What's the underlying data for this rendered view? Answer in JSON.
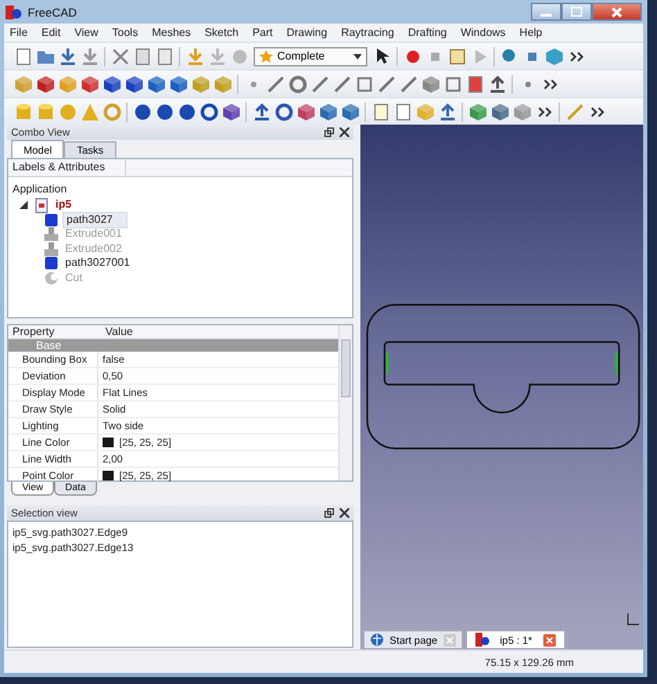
{
  "window": {
    "title": "FreeCAD"
  },
  "menu": [
    "File",
    "Edit",
    "View",
    "Tools",
    "Meshes",
    "Sketch",
    "Part",
    "Drawing",
    "Raytracing",
    "Drafting",
    "Windows",
    "Help"
  ],
  "toolbar": {
    "workbench": "Complete"
  },
  "combo_view": {
    "title": "Combo View",
    "tabs": [
      {
        "label": "Model",
        "selected": true
      },
      {
        "label": "Tasks",
        "selected": false
      }
    ],
    "tree": {
      "header": "Labels & Attributes",
      "root": "Application",
      "items": [
        {
          "label": "ip5",
          "kind": "document",
          "expanded": true,
          "visible": true,
          "selected": false,
          "children": [
            {
              "label": "path3027",
              "kind": "part",
              "visible": true,
              "selected": true
            },
            {
              "label": "Extrude001",
              "kind": "extrude",
              "visible": false,
              "selected": false
            },
            {
              "label": "Extrude002",
              "kind": "extrude",
              "visible": false,
              "selected": false
            },
            {
              "label": "path3027001",
              "kind": "part",
              "visible": true,
              "selected": false
            },
            {
              "label": "Cut",
              "kind": "cut",
              "visible": false,
              "selected": false
            }
          ]
        }
      ]
    },
    "properties": {
      "columns": [
        "Property",
        "Value"
      ],
      "groups": [
        {
          "name": "Base",
          "rows": [
            {
              "property": "Bounding Box",
              "value": "false"
            },
            {
              "property": "Deviation",
              "value": "0,50"
            },
            {
              "property": "Display Mode",
              "value": "Flat Lines"
            },
            {
              "property": "Draw Style",
              "value": "Solid"
            },
            {
              "property": "Lighting",
              "value": "Two side"
            },
            {
              "property": "Line Color",
              "value": "[25, 25, 25]",
              "color": "#191919"
            },
            {
              "property": "Line Width",
              "value": "2,00"
            },
            {
              "property": "Point Color",
              "value": "[25, 25, 25]",
              "color": "#191919"
            }
          ]
        }
      ],
      "tabs": [
        {
          "label": "View",
          "selected": true
        },
        {
          "label": "Data",
          "selected": false
        }
      ]
    }
  },
  "selection_view": {
    "title": "Selection view",
    "items": [
      "ip5_svg.path3027.Edge9",
      "ip5_svg.path3027.Edge13"
    ]
  },
  "document_tabs": [
    {
      "label": "Start page",
      "kind": "web",
      "selected": false
    },
    {
      "label": "ip5 : 1*",
      "kind": "model",
      "selected": true
    }
  ],
  "status_bar": {
    "dimensions": "75.15 x 129.26 mm"
  }
}
